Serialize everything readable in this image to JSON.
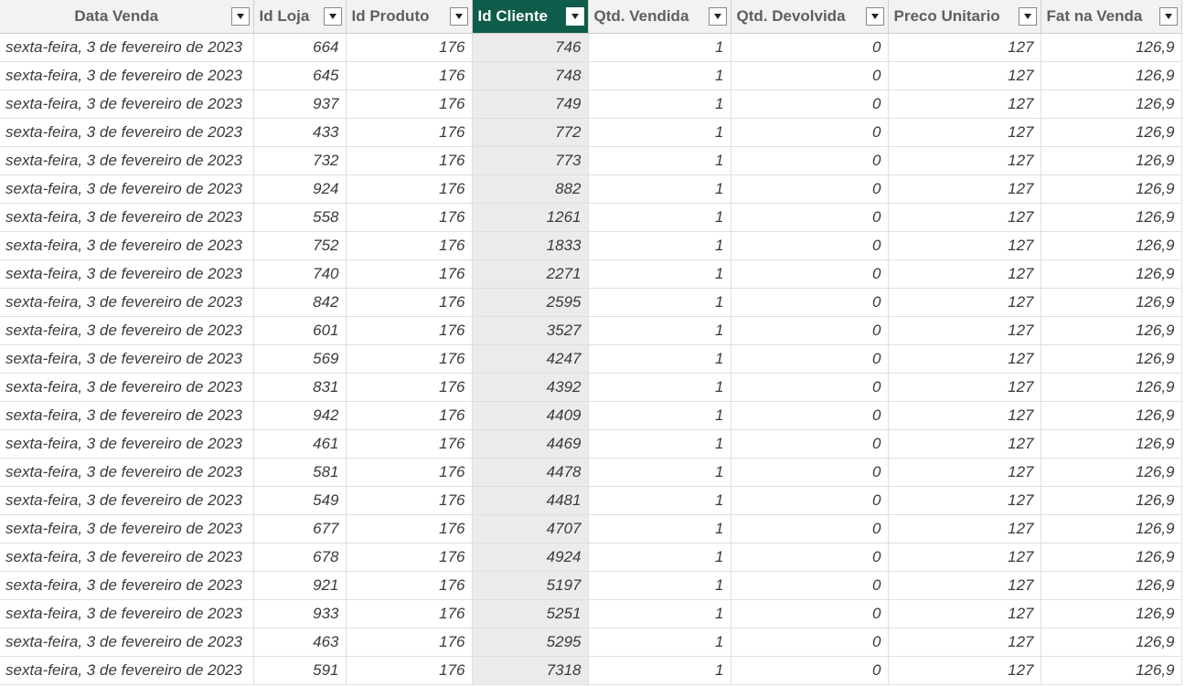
{
  "columns": [
    {
      "label": "Data Venda"
    },
    {
      "label": "Id Loja"
    },
    {
      "label": "Id Produto"
    },
    {
      "label": "Id Cliente"
    },
    {
      "label": "Qtd. Vendida"
    },
    {
      "label": "Qtd. Devolvida"
    },
    {
      "label": "Preco Unitario"
    },
    {
      "label": "Fat na Venda"
    }
  ],
  "selected_column": "Id Cliente",
  "colors": {
    "selected_header": "#0e5c49",
    "selected_column_bg": "#edebe9",
    "header_bg": "#f3f2f1"
  },
  "icons": {
    "filter": "filter-dropdown-icon"
  },
  "rows": [
    [
      "sexta-feira, 3 de fevereiro de 2023",
      "664",
      "176",
      "746",
      "1",
      "0",
      "127",
      "126,9"
    ],
    [
      "sexta-feira, 3 de fevereiro de 2023",
      "645",
      "176",
      "748",
      "1",
      "0",
      "127",
      "126,9"
    ],
    [
      "sexta-feira, 3 de fevereiro de 2023",
      "937",
      "176",
      "749",
      "1",
      "0",
      "127",
      "126,9"
    ],
    [
      "sexta-feira, 3 de fevereiro de 2023",
      "433",
      "176",
      "772",
      "1",
      "0",
      "127",
      "126,9"
    ],
    [
      "sexta-feira, 3 de fevereiro de 2023",
      "732",
      "176",
      "773",
      "1",
      "0",
      "127",
      "126,9"
    ],
    [
      "sexta-feira, 3 de fevereiro de 2023",
      "924",
      "176",
      "882",
      "1",
      "0",
      "127",
      "126,9"
    ],
    [
      "sexta-feira, 3 de fevereiro de 2023",
      "558",
      "176",
      "1261",
      "1",
      "0",
      "127",
      "126,9"
    ],
    [
      "sexta-feira, 3 de fevereiro de 2023",
      "752",
      "176",
      "1833",
      "1",
      "0",
      "127",
      "126,9"
    ],
    [
      "sexta-feira, 3 de fevereiro de 2023",
      "740",
      "176",
      "2271",
      "1",
      "0",
      "127",
      "126,9"
    ],
    [
      "sexta-feira, 3 de fevereiro de 2023",
      "842",
      "176",
      "2595",
      "1",
      "0",
      "127",
      "126,9"
    ],
    [
      "sexta-feira, 3 de fevereiro de 2023",
      "601",
      "176",
      "3527",
      "1",
      "0",
      "127",
      "126,9"
    ],
    [
      "sexta-feira, 3 de fevereiro de 2023",
      "569",
      "176",
      "4247",
      "1",
      "0",
      "127",
      "126,9"
    ],
    [
      "sexta-feira, 3 de fevereiro de 2023",
      "831",
      "176",
      "4392",
      "1",
      "0",
      "127",
      "126,9"
    ],
    [
      "sexta-feira, 3 de fevereiro de 2023",
      "942",
      "176",
      "4409",
      "1",
      "0",
      "127",
      "126,9"
    ],
    [
      "sexta-feira, 3 de fevereiro de 2023",
      "461",
      "176",
      "4469",
      "1",
      "0",
      "127",
      "126,9"
    ],
    [
      "sexta-feira, 3 de fevereiro de 2023",
      "581",
      "176",
      "4478",
      "1",
      "0",
      "127",
      "126,9"
    ],
    [
      "sexta-feira, 3 de fevereiro de 2023",
      "549",
      "176",
      "4481",
      "1",
      "0",
      "127",
      "126,9"
    ],
    [
      "sexta-feira, 3 de fevereiro de 2023",
      "677",
      "176",
      "4707",
      "1",
      "0",
      "127",
      "126,9"
    ],
    [
      "sexta-feira, 3 de fevereiro de 2023",
      "678",
      "176",
      "4924",
      "1",
      "0",
      "127",
      "126,9"
    ],
    [
      "sexta-feira, 3 de fevereiro de 2023",
      "921",
      "176",
      "5197",
      "1",
      "0",
      "127",
      "126,9"
    ],
    [
      "sexta-feira, 3 de fevereiro de 2023",
      "933",
      "176",
      "5251",
      "1",
      "0",
      "127",
      "126,9"
    ],
    [
      "sexta-feira, 3 de fevereiro de 2023",
      "463",
      "176",
      "5295",
      "1",
      "0",
      "127",
      "126,9"
    ],
    [
      "sexta-feira, 3 de fevereiro de 2023",
      "591",
      "176",
      "7318",
      "1",
      "0",
      "127",
      "126,9"
    ]
  ]
}
